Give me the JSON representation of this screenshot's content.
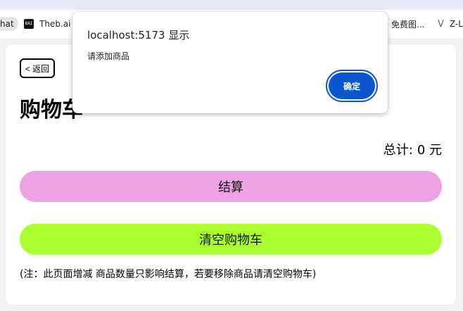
{
  "bookmarks": [
    {
      "label": "hat"
    },
    {
      "icon": "BAI",
      "label": "Theb.ai"
    },
    {
      "label": "免费图..."
    },
    {
      "icon": "V",
      "label": "Z-L"
    }
  ],
  "page": {
    "back_label": "< 返回",
    "title": "购物车",
    "total_label": "总计:",
    "total_value": "0 元",
    "checkout_label": "结算",
    "clear_label": "清空购物车",
    "note": "(注：此页面增减 商品数量只影响结算，若要移除商品请清空购物车)"
  },
  "dialog": {
    "title": "localhost:5173 显示",
    "message": "请添加商品",
    "ok_label": "确定"
  },
  "colors": {
    "checkout": "#eea2e6",
    "clear": "#acff2f",
    "dialog_button": "#0b57d0"
  }
}
